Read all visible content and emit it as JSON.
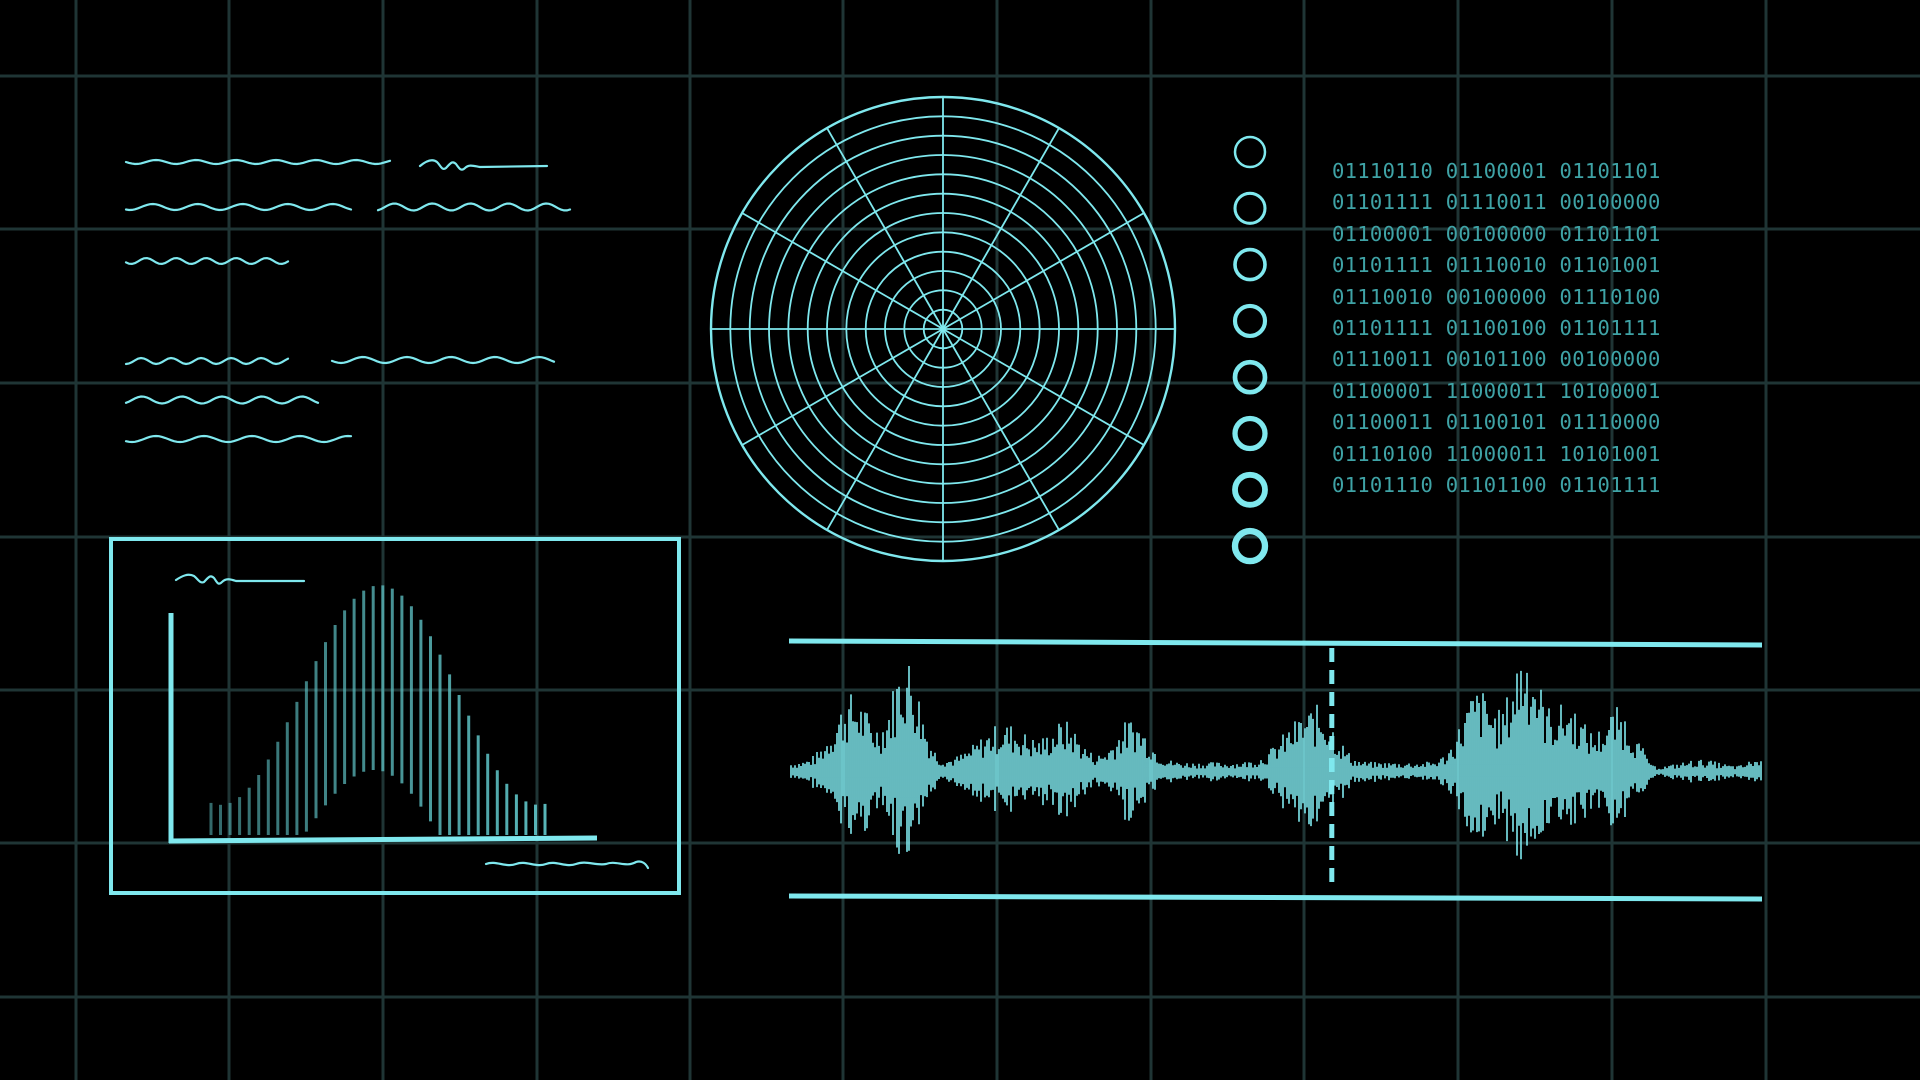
{
  "colors": {
    "background": "#000000",
    "grid": "#1f3535",
    "accent": "#7fe8ee",
    "accent_dim": "#5dbfc2",
    "binary_text": "#3fa3a6"
  },
  "binary_panel": {
    "rows": [
      "01110110 01100001 01101101",
      "01101111 01110011 00100000",
      "01100001 00100000 01101101",
      "01101111 01110010 01101001",
      "01110010 00100000 01110100",
      "01101111 01100100 01101111",
      "01110011 00101100 00100000",
      "01100001 11000011 10100001",
      "01100011 01100101 01110000",
      "01110100 11000011 10101001",
      "01101110 01101100 01101111"
    ]
  },
  "indicator_column": {
    "count": 8
  },
  "radar": {
    "rings": 12,
    "spokes": 12
  },
  "waveform_panel": {
    "playhead_fraction": 0.557
  }
}
